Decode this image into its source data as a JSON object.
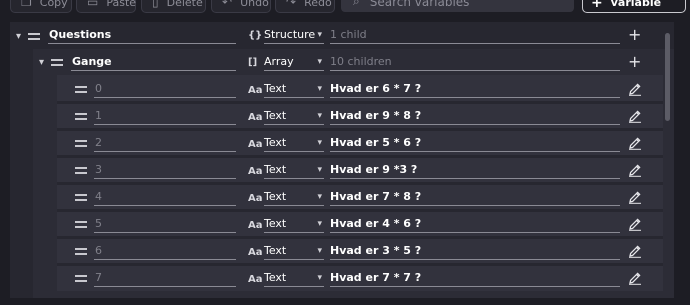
{
  "toolbar": {
    "copy": "Copy",
    "paste": "Paste",
    "delete": "Delete",
    "undo": "Undo",
    "redo": "Redo",
    "search_placeholder": "Search variables",
    "add_variable": "Add variable"
  },
  "root": {
    "name": "Questions",
    "type_icon": "{}",
    "type": "Structure",
    "summary": "1 child"
  },
  "child": {
    "name": "Gange",
    "type_icon": "[]",
    "type": "Array",
    "summary": "10 children"
  },
  "items": [
    {
      "index": "0",
      "type_icon": "Aa",
      "type": "Text",
      "value": "Hvad er 6 * 7 ?"
    },
    {
      "index": "1",
      "type_icon": "Aa",
      "type": "Text",
      "value": "Hvad er 9 * 8 ?"
    },
    {
      "index": "2",
      "type_icon": "Aa",
      "type": "Text",
      "value": "Hvad er 5 * 6 ?"
    },
    {
      "index": "3",
      "type_icon": "Aa",
      "type": "Text",
      "value": "Hvad er 9 *3 ?"
    },
    {
      "index": "4",
      "type_icon": "Aa",
      "type": "Text",
      "value": "Hvad er 7 * 8 ?"
    },
    {
      "index": "5",
      "type_icon": "Aa",
      "type": "Text",
      "value": "Hvad er 4 * 6 ?"
    },
    {
      "index": "6",
      "type_icon": "Aa",
      "type": "Text",
      "value": "Hvad er 3 * 5 ?"
    },
    {
      "index": "7",
      "type_icon": "Aa",
      "type": "Text",
      "value": "Hvad er 7 * 7 ?"
    }
  ]
}
